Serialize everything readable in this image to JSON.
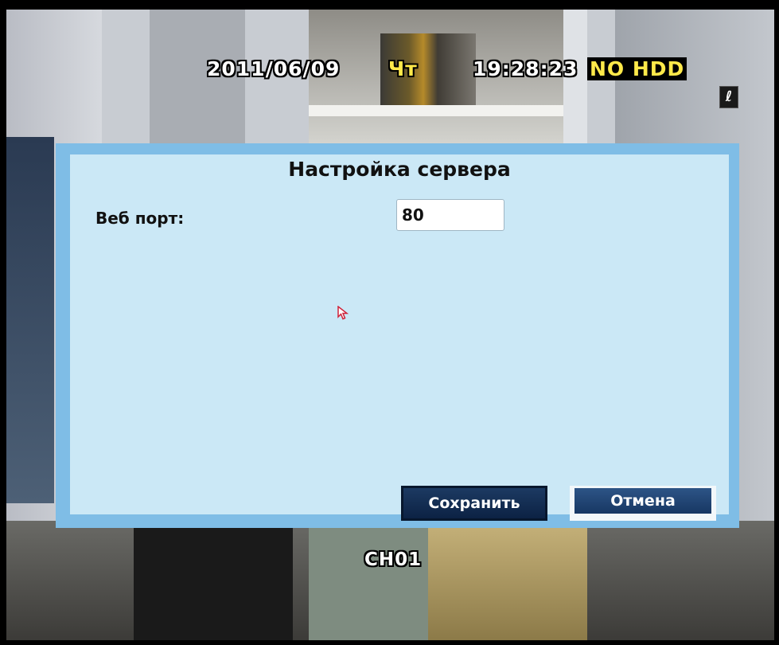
{
  "osd": {
    "date": "2011/06/09",
    "day": "Чт",
    "time": "19:28:23",
    "hdd_status": "NO HDD",
    "channel": "CH01",
    "status_icon": "ℓ"
  },
  "dialog": {
    "title": "Настройка сервера",
    "web_port_label": "Веб порт:",
    "web_port_value": "80",
    "save_label": "Сохранить",
    "cancel_label": "Отмена"
  },
  "colors": {
    "dialog_frame": "#7fbde6",
    "dialog_body": "#cbe8f6",
    "button": "#173763",
    "osd_yellow": "#ffe94a"
  }
}
